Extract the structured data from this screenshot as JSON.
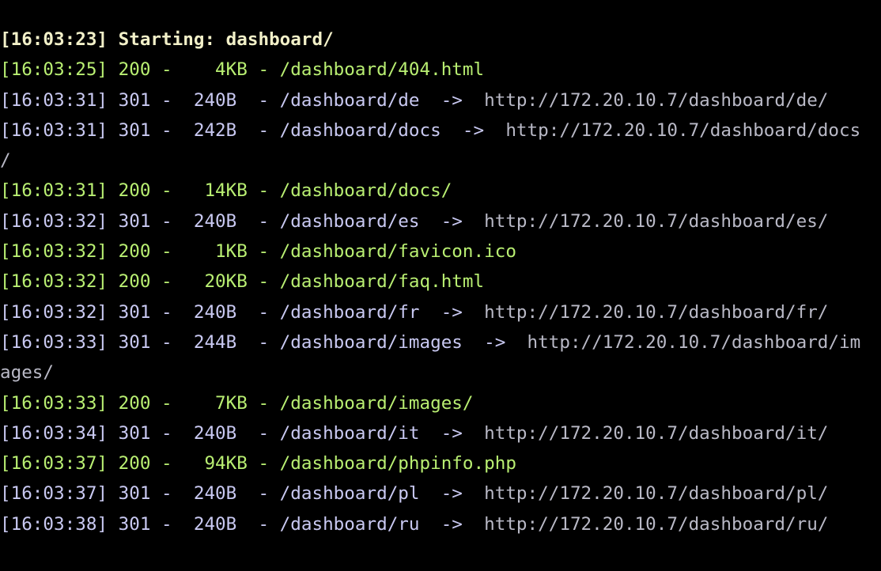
{
  "terminal": {
    "colors": {
      "background": "#000000",
      "header": "#f2f0c8",
      "status_200": "#b9ef72",
      "status_301": "#c9c9f2",
      "redirect_target": "#b9b9c6"
    },
    "lines": [
      {
        "kind": "header",
        "text": "[16:03:23] Starting: dashboard/"
      },
      {
        "kind": "ok",
        "text": "[16:03:25] 200 -    4KB - /dashboard/404.html"
      },
      {
        "kind": "redir",
        "text": "[16:03:31] 301 -  240B  - /dashboard/de  ->  ",
        "target": "http://172.20.10.7/dashboard/de/"
      },
      {
        "kind": "redir",
        "text": "[16:03:31] 301 -  242B  - /dashboard/docs  ->  ",
        "target": "http://172.20.10.7/dashboard/docs"
      },
      {
        "kind": "cont",
        "text": "/"
      },
      {
        "kind": "ok",
        "text": "[16:03:31] 200 -   14KB - /dashboard/docs/"
      },
      {
        "kind": "redir",
        "text": "[16:03:32] 301 -  240B  - /dashboard/es  ->  ",
        "target": "http://172.20.10.7/dashboard/es/"
      },
      {
        "kind": "ok",
        "text": "[16:03:32] 200 -    1KB - /dashboard/favicon.ico"
      },
      {
        "kind": "ok",
        "text": "[16:03:32] 200 -   20KB - /dashboard/faq.html"
      },
      {
        "kind": "redir",
        "text": "[16:03:32] 301 -  240B  - /dashboard/fr  ->  ",
        "target": "http://172.20.10.7/dashboard/fr/"
      },
      {
        "kind": "redir",
        "text": "[16:03:33] 301 -  244B  - /dashboard/images  ->  ",
        "target": "http://172.20.10.7/dashboard/im"
      },
      {
        "kind": "cont",
        "text": "ages/"
      },
      {
        "kind": "ok",
        "text": "[16:03:33] 200 -    7KB - /dashboard/images/"
      },
      {
        "kind": "redir",
        "text": "[16:03:34] 301 -  240B  - /dashboard/it  ->  ",
        "target": "http://172.20.10.7/dashboard/it/"
      },
      {
        "kind": "ok",
        "text": "[16:03:37] 200 -   94KB - /dashboard/phpinfo.php"
      },
      {
        "kind": "redir",
        "text": "[16:03:37] 301 -  240B  - /dashboard/pl  ->  ",
        "target": "http://172.20.10.7/dashboard/pl/"
      },
      {
        "kind": "redir",
        "text": "[16:03:38] 301 -  240B  - /dashboard/ru  ->  ",
        "target": "http://172.20.10.7/dashboard/ru/"
      }
    ]
  }
}
